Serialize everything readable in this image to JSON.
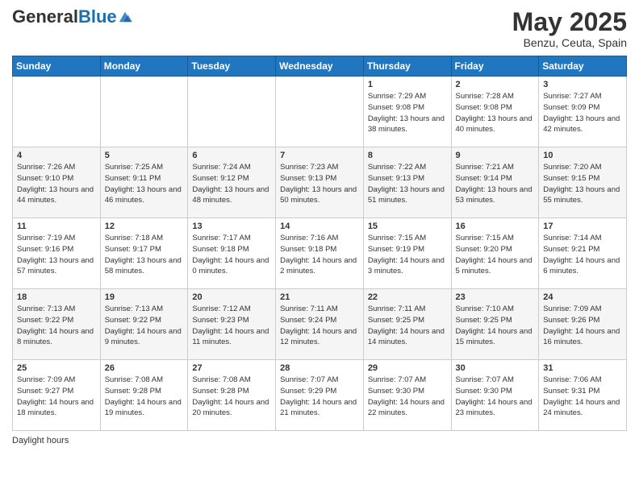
{
  "header": {
    "logo_general": "General",
    "logo_blue": "Blue",
    "month_title": "May 2025",
    "location": "Benzu, Ceuta, Spain"
  },
  "days_of_week": [
    "Sunday",
    "Monday",
    "Tuesday",
    "Wednesday",
    "Thursday",
    "Friday",
    "Saturday"
  ],
  "footer": {
    "note": "Daylight hours"
  },
  "weeks": [
    [
      {
        "day": "",
        "info": ""
      },
      {
        "day": "",
        "info": ""
      },
      {
        "day": "",
        "info": ""
      },
      {
        "day": "",
        "info": ""
      },
      {
        "day": "1",
        "info": "Sunrise: 7:29 AM\nSunset: 9:08 PM\nDaylight: 13 hours\nand 38 minutes."
      },
      {
        "day": "2",
        "info": "Sunrise: 7:28 AM\nSunset: 9:08 PM\nDaylight: 13 hours\nand 40 minutes."
      },
      {
        "day": "3",
        "info": "Sunrise: 7:27 AM\nSunset: 9:09 PM\nDaylight: 13 hours\nand 42 minutes."
      }
    ],
    [
      {
        "day": "4",
        "info": "Sunrise: 7:26 AM\nSunset: 9:10 PM\nDaylight: 13 hours\nand 44 minutes."
      },
      {
        "day": "5",
        "info": "Sunrise: 7:25 AM\nSunset: 9:11 PM\nDaylight: 13 hours\nand 46 minutes."
      },
      {
        "day": "6",
        "info": "Sunrise: 7:24 AM\nSunset: 9:12 PM\nDaylight: 13 hours\nand 48 minutes."
      },
      {
        "day": "7",
        "info": "Sunrise: 7:23 AM\nSunset: 9:13 PM\nDaylight: 13 hours\nand 50 minutes."
      },
      {
        "day": "8",
        "info": "Sunrise: 7:22 AM\nSunset: 9:13 PM\nDaylight: 13 hours\nand 51 minutes."
      },
      {
        "day": "9",
        "info": "Sunrise: 7:21 AM\nSunset: 9:14 PM\nDaylight: 13 hours\nand 53 minutes."
      },
      {
        "day": "10",
        "info": "Sunrise: 7:20 AM\nSunset: 9:15 PM\nDaylight: 13 hours\nand 55 minutes."
      }
    ],
    [
      {
        "day": "11",
        "info": "Sunrise: 7:19 AM\nSunset: 9:16 PM\nDaylight: 13 hours\nand 57 minutes."
      },
      {
        "day": "12",
        "info": "Sunrise: 7:18 AM\nSunset: 9:17 PM\nDaylight: 13 hours\nand 58 minutes."
      },
      {
        "day": "13",
        "info": "Sunrise: 7:17 AM\nSunset: 9:18 PM\nDaylight: 14 hours\nand 0 minutes."
      },
      {
        "day": "14",
        "info": "Sunrise: 7:16 AM\nSunset: 9:18 PM\nDaylight: 14 hours\nand 2 minutes."
      },
      {
        "day": "15",
        "info": "Sunrise: 7:15 AM\nSunset: 9:19 PM\nDaylight: 14 hours\nand 3 minutes."
      },
      {
        "day": "16",
        "info": "Sunrise: 7:15 AM\nSunset: 9:20 PM\nDaylight: 14 hours\nand 5 minutes."
      },
      {
        "day": "17",
        "info": "Sunrise: 7:14 AM\nSunset: 9:21 PM\nDaylight: 14 hours\nand 6 minutes."
      }
    ],
    [
      {
        "day": "18",
        "info": "Sunrise: 7:13 AM\nSunset: 9:22 PM\nDaylight: 14 hours\nand 8 minutes."
      },
      {
        "day": "19",
        "info": "Sunrise: 7:13 AM\nSunset: 9:22 PM\nDaylight: 14 hours\nand 9 minutes."
      },
      {
        "day": "20",
        "info": "Sunrise: 7:12 AM\nSunset: 9:23 PM\nDaylight: 14 hours\nand 11 minutes."
      },
      {
        "day": "21",
        "info": "Sunrise: 7:11 AM\nSunset: 9:24 PM\nDaylight: 14 hours\nand 12 minutes."
      },
      {
        "day": "22",
        "info": "Sunrise: 7:11 AM\nSunset: 9:25 PM\nDaylight: 14 hours\nand 14 minutes."
      },
      {
        "day": "23",
        "info": "Sunrise: 7:10 AM\nSunset: 9:25 PM\nDaylight: 14 hours\nand 15 minutes."
      },
      {
        "day": "24",
        "info": "Sunrise: 7:09 AM\nSunset: 9:26 PM\nDaylight: 14 hours\nand 16 minutes."
      }
    ],
    [
      {
        "day": "25",
        "info": "Sunrise: 7:09 AM\nSunset: 9:27 PM\nDaylight: 14 hours\nand 18 minutes."
      },
      {
        "day": "26",
        "info": "Sunrise: 7:08 AM\nSunset: 9:28 PM\nDaylight: 14 hours\nand 19 minutes."
      },
      {
        "day": "27",
        "info": "Sunrise: 7:08 AM\nSunset: 9:28 PM\nDaylight: 14 hours\nand 20 minutes."
      },
      {
        "day": "28",
        "info": "Sunrise: 7:07 AM\nSunset: 9:29 PM\nDaylight: 14 hours\nand 21 minutes."
      },
      {
        "day": "29",
        "info": "Sunrise: 7:07 AM\nSunset: 9:30 PM\nDaylight: 14 hours\nand 22 minutes."
      },
      {
        "day": "30",
        "info": "Sunrise: 7:07 AM\nSunset: 9:30 PM\nDaylight: 14 hours\nand 23 minutes."
      },
      {
        "day": "31",
        "info": "Sunrise: 7:06 AM\nSunset: 9:31 PM\nDaylight: 14 hours\nand 24 minutes."
      }
    ]
  ]
}
